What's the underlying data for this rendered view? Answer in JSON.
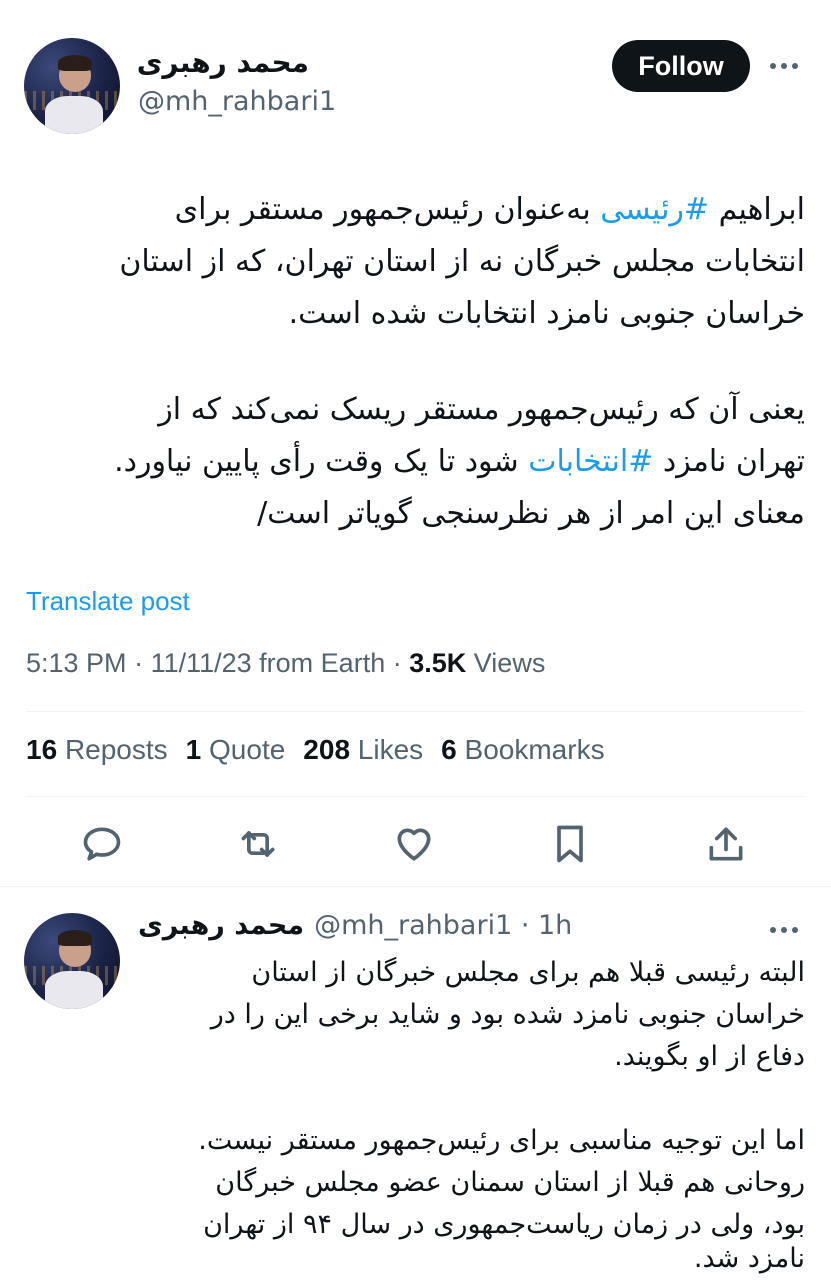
{
  "tweet": {
    "author_name": "محمد رهبری",
    "author_handle": "@mh_rahbari1",
    "follow_label": "Follow",
    "body_lines": [
      [
        "ابراهیم ",
        "#رئیسی",
        " به‌عنوان رئیس‌جمهور مستقر برای"
      ],
      [
        "انتخابات مجلس خبرگان نه از استان تهران، که از استان",
        "",
        ""
      ],
      [
        "خراسان جنوبی نامزد انتخابات شده است.",
        "",
        ""
      ],
      [
        "یعنی آن که رئیس‌جمهور مستقر ریسک نمی‌کند که از",
        "",
        ""
      ],
      [
        "تهران نامزد ",
        "#انتخابات",
        " شود تا یک وقت رأی پایین نیاورد."
      ],
      [
        "معنای این امر از هر نظرسنجی گویاتر است/",
        "",
        ""
      ]
    ],
    "translate_label": "Translate post",
    "time": "5:13 PM",
    "date": "11/11/23",
    "source": "from Earth",
    "views_count": "3.5K",
    "views_label": "Views",
    "reposts_count": "16",
    "reposts_label": "Reposts",
    "quote_count": "1",
    "quote_label": "Quote",
    "likes_count": "208",
    "likes_label": "Likes",
    "bookmarks_count": "6",
    "bookmarks_label": "Bookmarks"
  },
  "reply": {
    "author_name": "محمد رهبری",
    "author_handle": "@mh_rahbari1",
    "age": "1h",
    "body_lines": [
      "البته رئیسی قبلا هم برای مجلس خبرگان از استان",
      "خراسان جنوبی نامزد شده بود و شاید برخی این را در",
      "دفاع از او بگویند.",
      "اما این توجیه مناسبی برای رئیس‌جمهور مستقر نیست.",
      "روحانی هم قبلا از استان سمنان عضو مجلس خبرگان",
      "بود، ولی در زمان ریاست‌جمهوری در سال ۹۴ از تهران",
      "نامزد شد."
    ]
  },
  "icons": {
    "reply": "speech-bubble-icon",
    "repost": "repost-arrows-icon",
    "like": "heart-icon",
    "bookmark": "bookmark-icon",
    "share": "share-upload-icon",
    "more": "ellipsis-icon"
  },
  "colors": {
    "accent": "#1d9bf0",
    "text": "#0f1419",
    "muted": "#536471",
    "follow_bg": "#0f1419"
  }
}
